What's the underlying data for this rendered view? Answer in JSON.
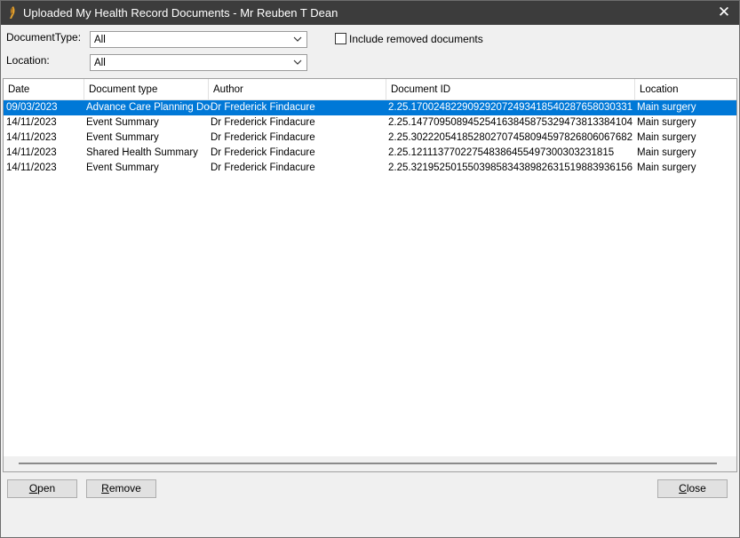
{
  "window": {
    "title": "Uploaded My Health Record Documents - Mr Reuben T Dean",
    "close_glyph": "✕"
  },
  "filters": {
    "document_type": {
      "label": "DocumentType:",
      "value": "All"
    },
    "location": {
      "label": "Location:",
      "value": "All"
    },
    "include_removed": {
      "label": "Include removed documents",
      "checked": false
    }
  },
  "table": {
    "columns": [
      "Date",
      "Document type",
      "Author",
      "Document ID",
      "Location"
    ],
    "selected_row": 0,
    "rows": [
      [
        "09/03/2023",
        "Advance Care Planning Docu",
        "Dr Frederick Findacure",
        "2.25.170024822909292072493418540287658030331",
        "Main surgery"
      ],
      [
        "14/11/2023",
        "Event Summary",
        "Dr Frederick Findacure",
        "2.25.147709508945254163845875329473813384104",
        "Main surgery"
      ],
      [
        "14/11/2023",
        "Event Summary",
        "Dr Frederick Findacure",
        "2.25.302220541852802707458094597826806067682",
        "Main surgery"
      ],
      [
        "14/11/2023",
        "Shared Health Summary",
        "Dr Frederick Findacure",
        "2.25.121113770227548386455497300303231815",
        "Main surgery"
      ],
      [
        "14/11/2023",
        "Event Summary",
        "Dr Frederick Findacure",
        "2.25.321952501550398583438982631519883936156",
        "Main surgery"
      ]
    ]
  },
  "buttons": {
    "open": {
      "mnemonic": "O",
      "rest": "pen"
    },
    "remove": {
      "mnemonic": "R",
      "rest": "emove"
    },
    "close": {
      "mnemonic": "C",
      "rest": "lose"
    }
  },
  "colors": {
    "titlebar": "#3c3c3c",
    "selection": "#0078d7",
    "window_bg": "#f0f0f0"
  }
}
